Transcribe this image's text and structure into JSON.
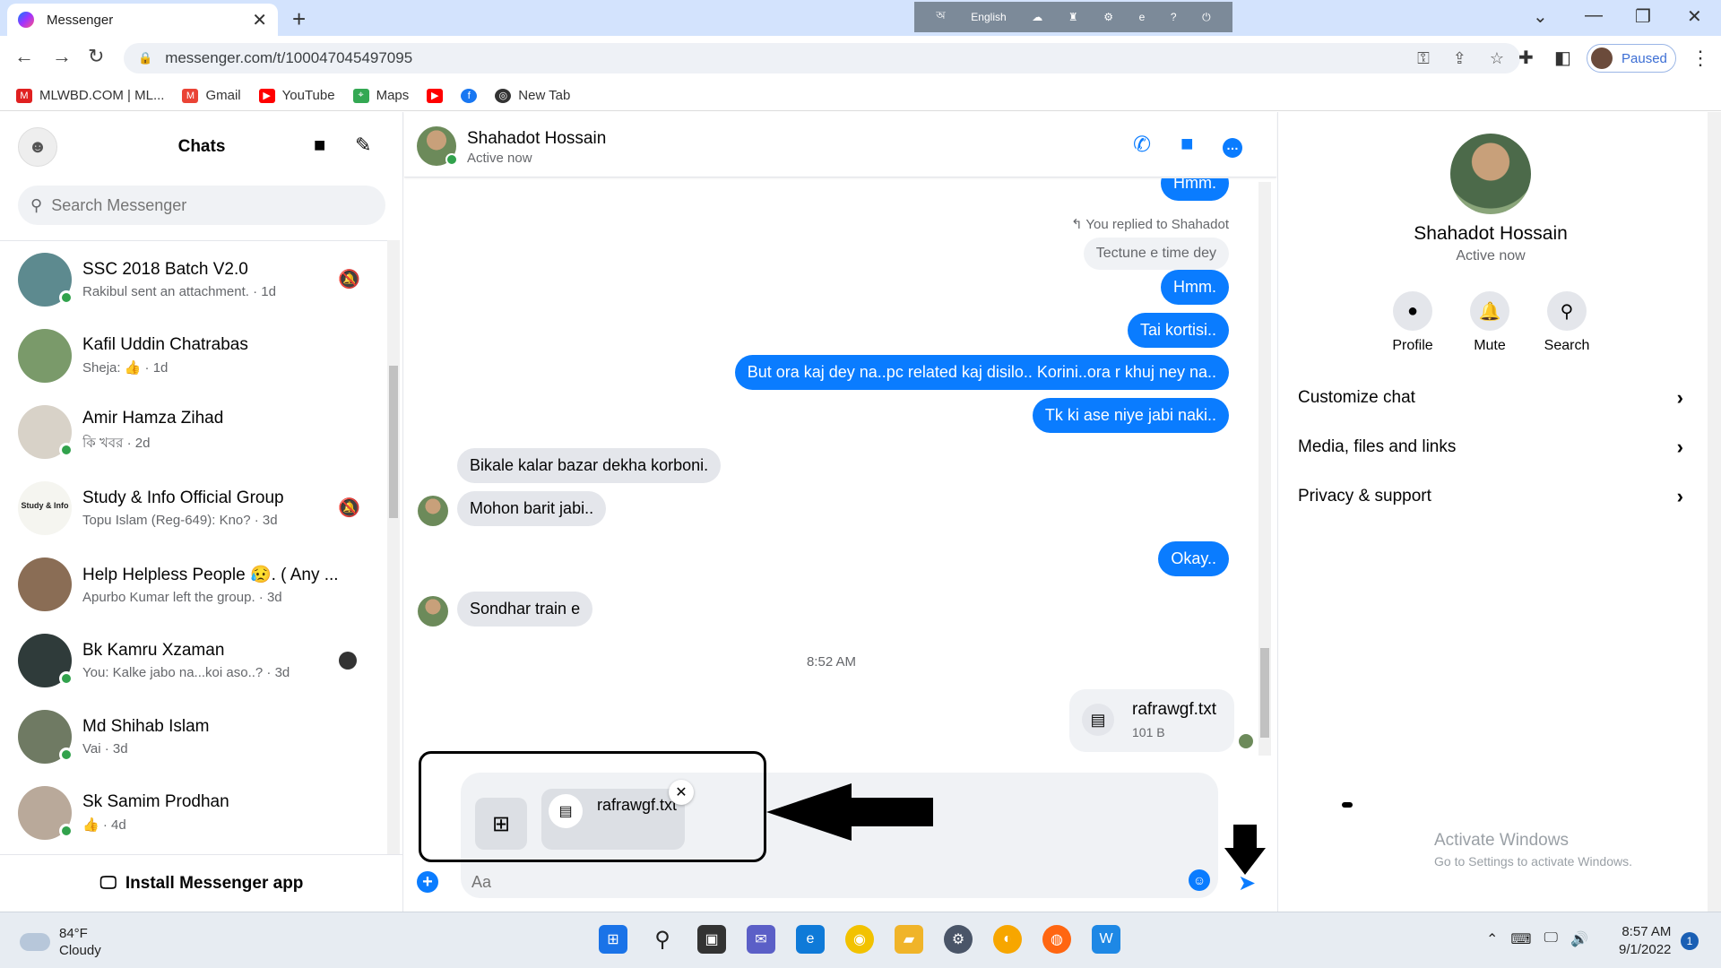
{
  "browser": {
    "tab_title": "Messenger",
    "url": "messenger.com/t/100047045497095",
    "profile_label": "Paused",
    "language_label": "English",
    "bookmarks": [
      {
        "label": "MLWBD.COM | ML...",
        "icon": "mlwbd-icon",
        "color": "#e02020"
      },
      {
        "label": "Gmail",
        "icon": "gmail-icon",
        "color": "#ea4335"
      },
      {
        "label": "YouTube",
        "icon": "youtube-icon",
        "color": "#ff0000"
      },
      {
        "label": "Maps",
        "icon": "maps-icon",
        "color": "#34a853"
      },
      {
        "label": "",
        "icon": "youtube-icon",
        "color": "#ff0000"
      },
      {
        "label": "",
        "icon": "facebook-icon",
        "color": "#1877f2"
      },
      {
        "label": "New Tab",
        "icon": "globe-icon",
        "color": "#333333"
      }
    ]
  },
  "sidebar": {
    "title": "Chats",
    "search_placeholder": "Search Messenger",
    "install_label": "Install Messenger app",
    "chats": [
      {
        "name": "SSC 2018 Batch V2.0",
        "preview": "Rakibul sent an attachment. · 1d",
        "online": true,
        "muted": true,
        "avatar_color": "#5d8a8f"
      },
      {
        "name": "Kafil Uddin Chatrabas",
        "preview": "Sheja: 👍 · 1d",
        "online": false,
        "muted": false,
        "avatar_color": "#7a9a6a"
      },
      {
        "name": "Amir Hamza Zihad",
        "preview": "কি খবর · 2d",
        "online": true,
        "muted": false,
        "avatar_color": "#d8d2c8"
      },
      {
        "name": "Study & Info Official Group",
        "preview": "Topu Islam (Reg-649): Kno? · 3d",
        "online": false,
        "muted": true,
        "avatar_color": "#f5f5f0",
        "avatar_text": "Study & Info"
      },
      {
        "name": "Help Helpless People 😥. ( Any ...",
        "preview": "Apurbo Kumar left the group. · 3d",
        "online": false,
        "muted": false,
        "avatar_color": "#8a6d55"
      },
      {
        "name": "Bk Kamru Xzaman",
        "preview": "You: Kalke jabo na...koi aso..? · 3d",
        "online": true,
        "muted": false,
        "seen": true,
        "avatar_color": "#2f3b3a"
      },
      {
        "name": "Md Shihab Islam",
        "preview": "Vai · 3d",
        "online": true,
        "muted": false,
        "avatar_color": "#6f7a63"
      },
      {
        "name": "Sk Samim Prodhan",
        "preview": "👍 · 4d",
        "online": true,
        "muted": false,
        "avatar_color": "#b9a99a"
      }
    ]
  },
  "conversation": {
    "contact_name": "Shahadot Hossain",
    "status": "Active now",
    "replied_note": "You replied to Shahadot",
    "quoted_text": "Tectune e time dey",
    "messages": [
      {
        "dir": "out",
        "text": "Hmm."
      },
      {
        "dir": "out",
        "text": "Hmm."
      },
      {
        "dir": "out",
        "text": "Tai kortisi.."
      },
      {
        "dir": "out",
        "text": "But ora kaj dey na..pc related kaj disilo.. Korini..ora r khuj ney na.."
      },
      {
        "dir": "out",
        "text": "Tk ki ase niye jabi naki.."
      },
      {
        "dir": "in",
        "text": "Bikale kalar bazar dekha korboni."
      },
      {
        "dir": "in",
        "text": "Mohon barit jabi.."
      },
      {
        "dir": "out",
        "text": "Okay.."
      },
      {
        "dir": "in",
        "text": "Sondhar train e"
      }
    ],
    "time_separator": "8:52 AM",
    "file": {
      "name": "rafrawgf.txt",
      "size": "101 B"
    },
    "composer": {
      "attachment_name": "rafrawgf.txt",
      "placeholder": "Aa"
    }
  },
  "info_panel": {
    "name": "Shahadot Hossain",
    "status": "Active now",
    "actions": [
      "Profile",
      "Mute",
      "Search"
    ],
    "rows": [
      "Customize chat",
      "Media, files and links",
      "Privacy & support"
    ],
    "activate_title": "Activate Windows",
    "activate_sub": "Go to Settings to activate Windows."
  },
  "taskbar": {
    "temperature": "84°F",
    "weather": "Cloudy",
    "time": "8:57 AM",
    "date": "9/1/2022",
    "notifications": "1"
  }
}
